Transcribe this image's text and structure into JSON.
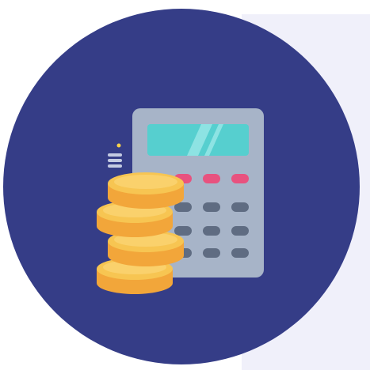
{
  "icon": {
    "name": "calculator-with-coins",
    "elements": [
      "calculator-icon",
      "coin-stack-icon",
      "motion-lines-icon",
      "sparkle-icon"
    ]
  },
  "colors": {
    "circle_background": "#353d87",
    "panel_background": "#f0f0fa",
    "calculator_body": "#a7b4c8",
    "calculator_screen": "#56cfcf",
    "calculator_screen_glare": "#8de3e3",
    "function_keys": "#e8527f",
    "number_keys": "#5f6c82",
    "coin_face": "#f7c552",
    "coin_edge": "#f2a63a",
    "coin_highlight": "#fde08b",
    "motion_lines": "#c4cbe2",
    "sparkle": "#f7d14a"
  }
}
